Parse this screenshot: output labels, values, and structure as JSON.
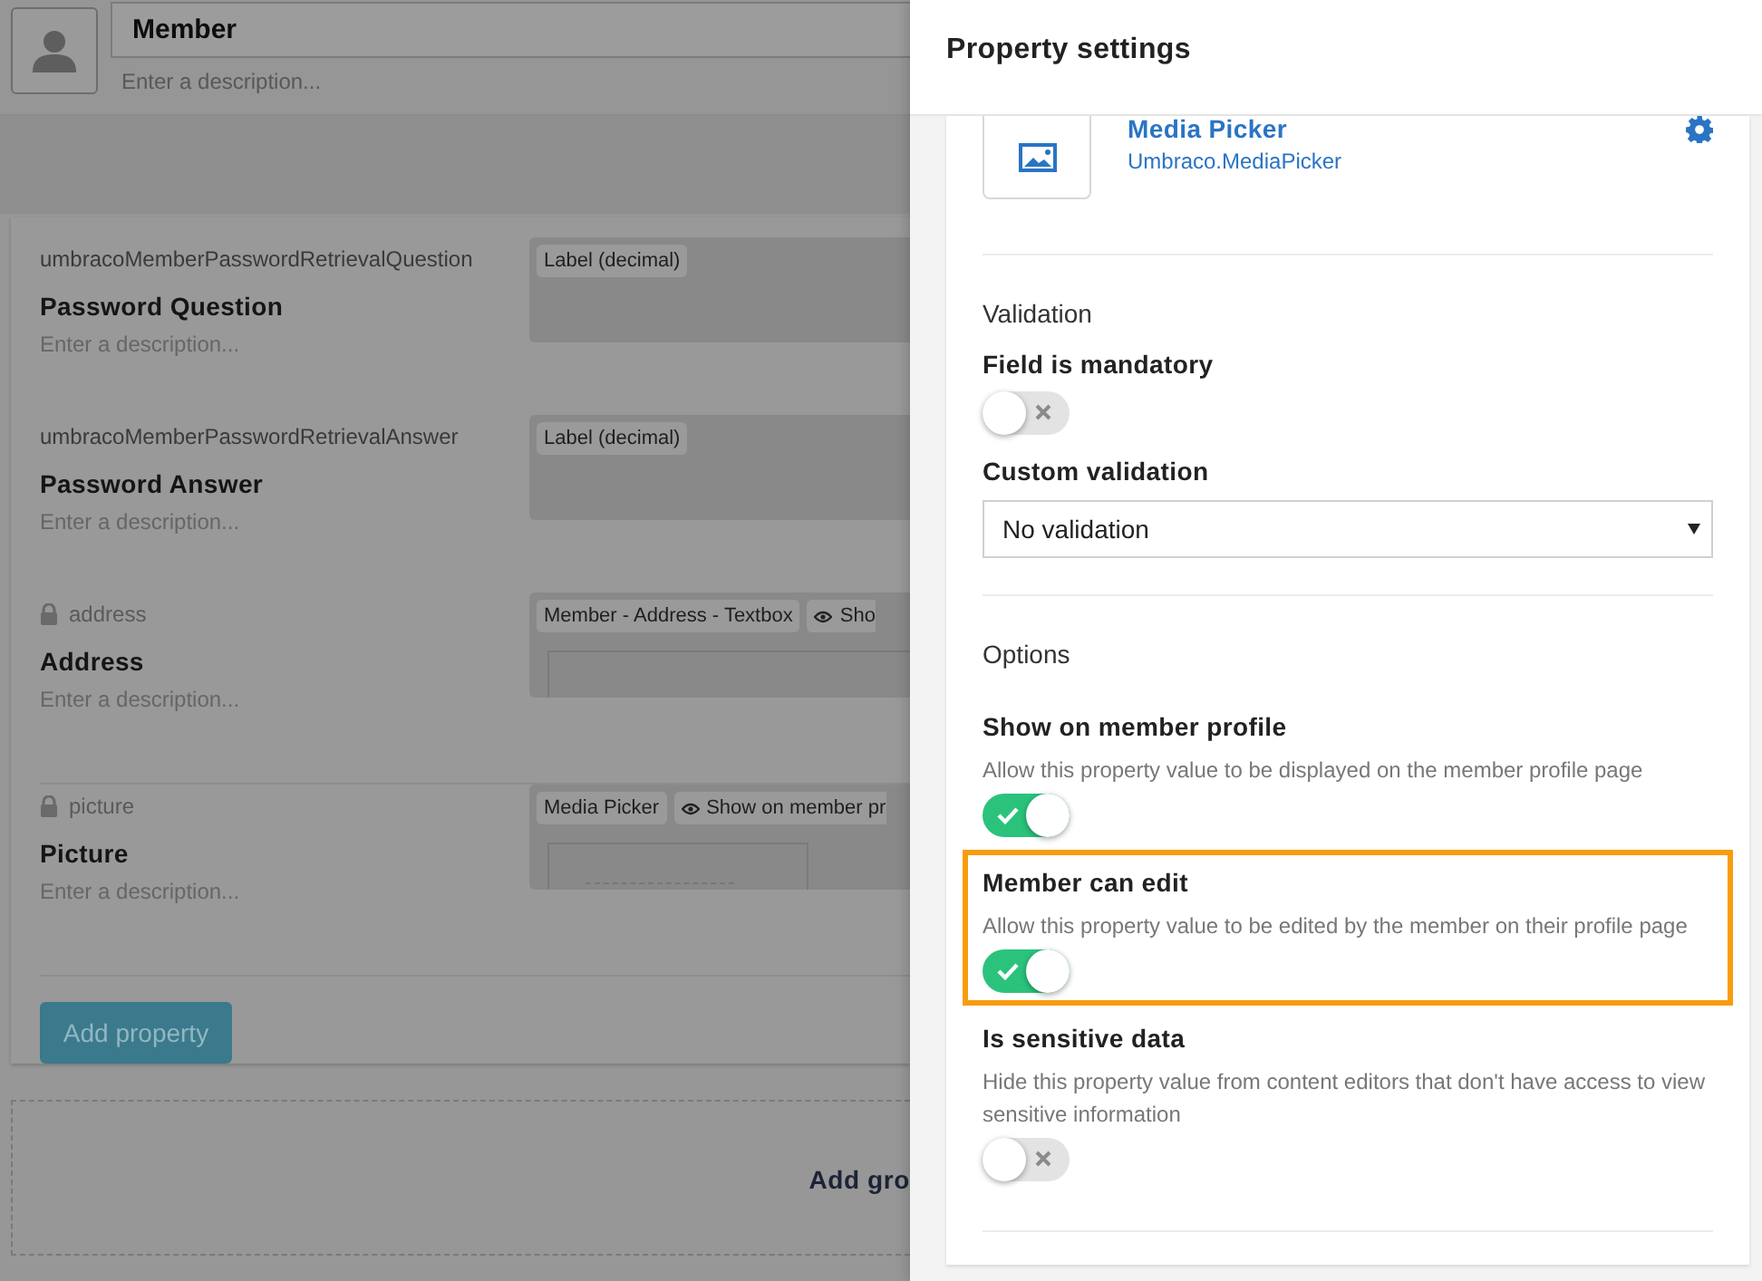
{
  "member_header": {
    "name": "Member",
    "description_placeholder": "Enter a description..."
  },
  "properties": [
    {
      "alias": "umbracoMemberPasswordRetrievalQuestion",
      "locked": false,
      "name": "Password Question",
      "description_placeholder": "Enter a description...",
      "kind": "label",
      "tags": [
        {
          "label": "Label (decimal)",
          "kind": "plain"
        }
      ]
    },
    {
      "alias": "umbracoMemberPasswordRetrievalAnswer",
      "locked": false,
      "name": "Password Answer",
      "description_placeholder": "Enter a description...",
      "kind": "label",
      "tags": [
        {
          "label": "Label (decimal)",
          "kind": "plain"
        }
      ]
    },
    {
      "alias": "address",
      "locked": true,
      "name": "Address",
      "description_placeholder": "Enter a description...",
      "kind": "textbox",
      "tags": [
        {
          "label": "Member - Address - Textbox",
          "kind": "plain"
        },
        {
          "label": "Sho",
          "kind": "eye"
        }
      ]
    },
    {
      "alias": "picture",
      "locked": true,
      "name": "Picture",
      "description_placeholder": "Enter a description...",
      "kind": "media",
      "tags": [
        {
          "label": "Media Picker",
          "kind": "plain"
        },
        {
          "label": "Show on member pr",
          "kind": "eye"
        }
      ]
    }
  ],
  "add_property_button": "Add property",
  "add_group_label": "Add gro",
  "panel": {
    "title": "Property settings",
    "editor": {
      "name": "Media Picker",
      "alias": "Umbraco.MediaPicker"
    },
    "validation": {
      "heading": "Validation",
      "mandatory": {
        "label": "Field is mandatory",
        "on": false
      },
      "custom_label": "Custom validation",
      "custom_value": "No validation"
    },
    "options": {
      "heading": "Options",
      "items": [
        {
          "label": "Show on member profile",
          "description": "Allow this property value to be displayed on the member profile page",
          "on": true,
          "highlighted": false
        },
        {
          "label": "Member can edit",
          "description": "Allow this property value to be edited by the member on their profile page",
          "on": true,
          "highlighted": true
        },
        {
          "label": "Is sensitive data",
          "description": "Hide this property value from content editors that don't have access to view sensitive information",
          "on": false,
          "highlighted": false
        }
      ]
    }
  }
}
